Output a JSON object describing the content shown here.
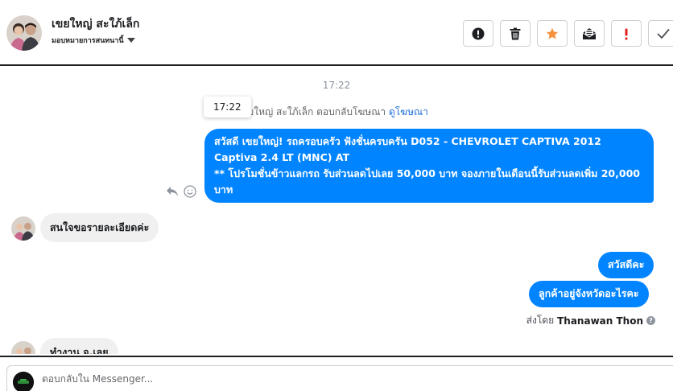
{
  "header": {
    "contact_name": "เขยใหญ่ สะใภ้เล็ก",
    "assign_label": "มอบหมายการสนทนานี้",
    "actions": [
      {
        "name": "spam-button",
        "icon": "exclamation-circle-icon"
      },
      {
        "name": "delete-button",
        "icon": "trash-icon"
      },
      {
        "name": "star-button",
        "icon": "star-icon",
        "color": "#f5923e"
      },
      {
        "name": "mark-unread-button",
        "icon": "envelope-icon"
      },
      {
        "name": "follow-up-button",
        "icon": "exclamation-icon",
        "color": "#e02020"
      },
      {
        "name": "done-button",
        "icon": "check-icon"
      }
    ]
  },
  "thread": {
    "timestamp": "17:22",
    "tooltip_time": "17:22",
    "reply_context": {
      "text": "ขยใหญ่ สะใภ้เล็ก ตอบกลับโฆษณา",
      "link": "ดูโฆษณา"
    },
    "ad_message": {
      "line1": "สวัสดี เขยใหญ่! รถครอบครัว ฟังชั่นครบครัน D052 - CHEVROLET CAPTIVA 2012 Captiva 2.4 LT (MNC) AT",
      "line2": "** โปรโมชั่นข้าวแลกรถ รับส่วนลดไปเลย 50,000 บาท จองภายในเดือนนี้รับส่วนลดเพิ่ม 20,000 บาท"
    },
    "incoming_1": "สนใจขอรายละเอียดค่ะ",
    "outgoing_1": "สวัสดีคะ",
    "outgoing_2": "ลูกค้าอยู่จังหวัดอะไรคะ",
    "sent_by_prefix": "ส่งโดย",
    "sent_by_name": "Thanawan Thon",
    "incoming_2": "ทำงาน จ.เลย"
  },
  "composer": {
    "placeholder": "ตอบกลับใน Messenger..."
  },
  "colors": {
    "accent": "#0084ff",
    "incoming_bubble": "#f0f0f0",
    "star": "#f5923e",
    "alert": "#e02020"
  }
}
